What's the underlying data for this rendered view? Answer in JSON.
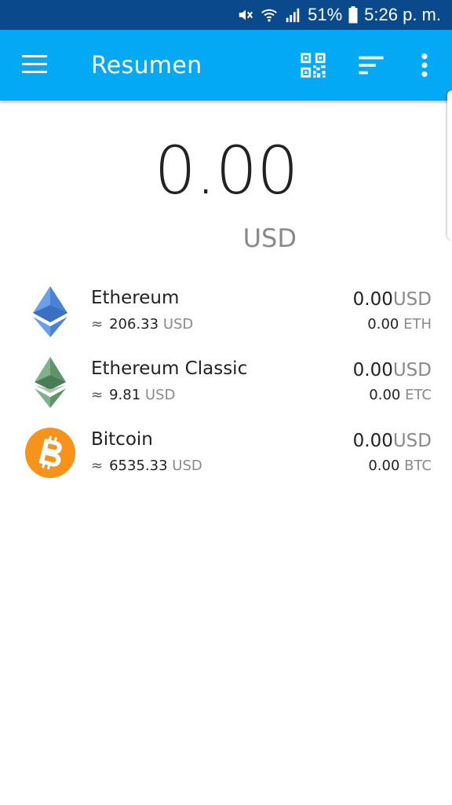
{
  "status_bar": {
    "battery": "51%",
    "time": "5:26 p. m."
  },
  "app_bar": {
    "title": "Resumen",
    "menu_icon": "hamburger-menu-icon",
    "actions": [
      "qr-code-icon",
      "sort-icon",
      "more-vert-icon"
    ],
    "color": "#03a9f4"
  },
  "summary": {
    "total": "0.00",
    "currency": "USD"
  },
  "assets": [
    {
      "name": "Ethereum",
      "approx": "≈",
      "rate": "206.33",
      "rate_currency": "USD",
      "value": "0.00",
      "value_currency": "USD",
      "balance": "0.00",
      "symbol": "ETH",
      "icon": "ethereum-icon"
    },
    {
      "name": "Ethereum Classic",
      "approx": "≈",
      "rate": "9.81",
      "rate_currency": "USD",
      "value": "0.00",
      "value_currency": "USD",
      "balance": "0.00",
      "symbol": "ETC",
      "icon": "ethereum-classic-icon"
    },
    {
      "name": "Bitcoin",
      "approx": "≈",
      "rate": "6535.33",
      "rate_currency": "USD",
      "value": "0.00",
      "value_currency": "USD",
      "balance": "0.00",
      "symbol": "BTC",
      "icon": "bitcoin-icon"
    }
  ]
}
